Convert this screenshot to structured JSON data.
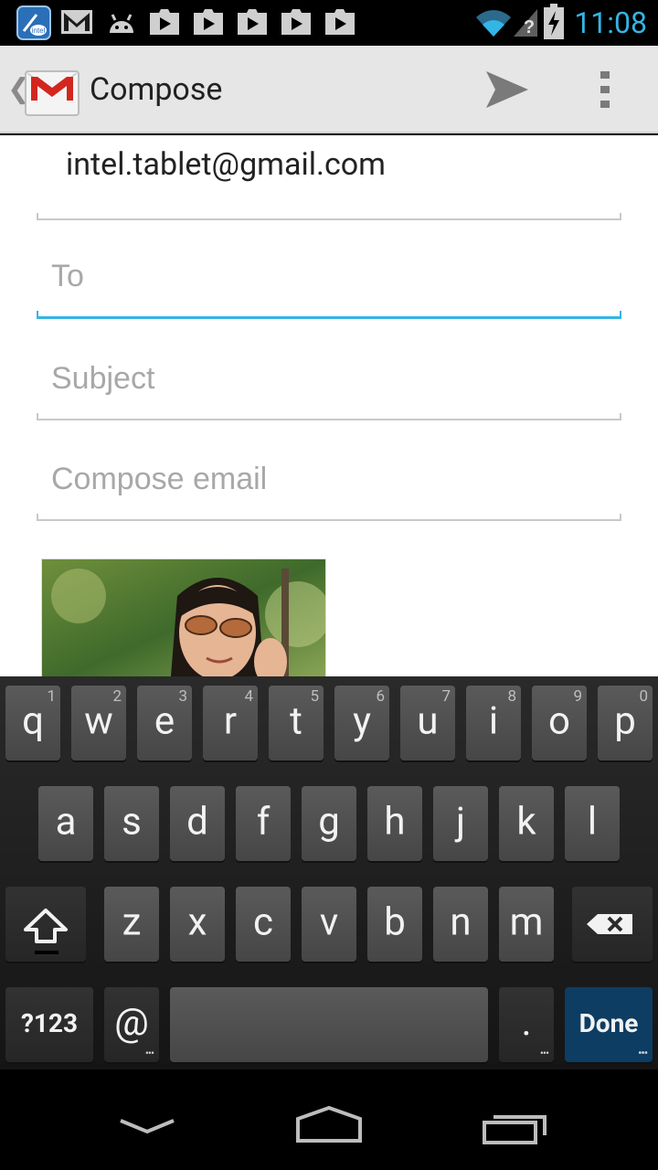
{
  "status_bar": {
    "time": "11:08",
    "left_icons": [
      "intel-app-icon",
      "gmail-icon",
      "android-icon",
      "play-store-icon",
      "play-store-icon",
      "play-store-icon",
      "play-store-icon",
      "play-store-icon"
    ],
    "right_icons": [
      "wifi-icon",
      "signal-unknown-icon",
      "battery-charging-icon"
    ],
    "accent_color": "#33b5e5"
  },
  "action_bar": {
    "title": "Compose",
    "app_icon": "gmail-envelope-icon",
    "actions": [
      "send-icon",
      "overflow-menu-icon"
    ]
  },
  "compose": {
    "from": "intel.tablet@gmail.com",
    "to_placeholder": "To",
    "to_value": "",
    "subject_placeholder": "Subject",
    "subject_value": "",
    "body_placeholder": "Compose email",
    "body_value": "",
    "attachment": "photo-thumbnail"
  },
  "keyboard": {
    "row1": [
      {
        "label": "q",
        "hint": "1"
      },
      {
        "label": "w",
        "hint": "2"
      },
      {
        "label": "e",
        "hint": "3"
      },
      {
        "label": "r",
        "hint": "4"
      },
      {
        "label": "t",
        "hint": "5"
      },
      {
        "label": "y",
        "hint": "6"
      },
      {
        "label": "u",
        "hint": "7"
      },
      {
        "label": "i",
        "hint": "8"
      },
      {
        "label": "o",
        "hint": "9"
      },
      {
        "label": "p",
        "hint": "0"
      }
    ],
    "row2": [
      "a",
      "s",
      "d",
      "f",
      "g",
      "h",
      "j",
      "k",
      "l"
    ],
    "row3": [
      "z",
      "x",
      "c",
      "v",
      "b",
      "n",
      "m"
    ],
    "symbols_label": "?123",
    "at_label": "@",
    "period_label": ".",
    "done_label": "Done",
    "done_color": "#0d3d63"
  },
  "nav_bar": {
    "buttons": [
      "back-icon",
      "home-icon",
      "recents-icon"
    ]
  }
}
